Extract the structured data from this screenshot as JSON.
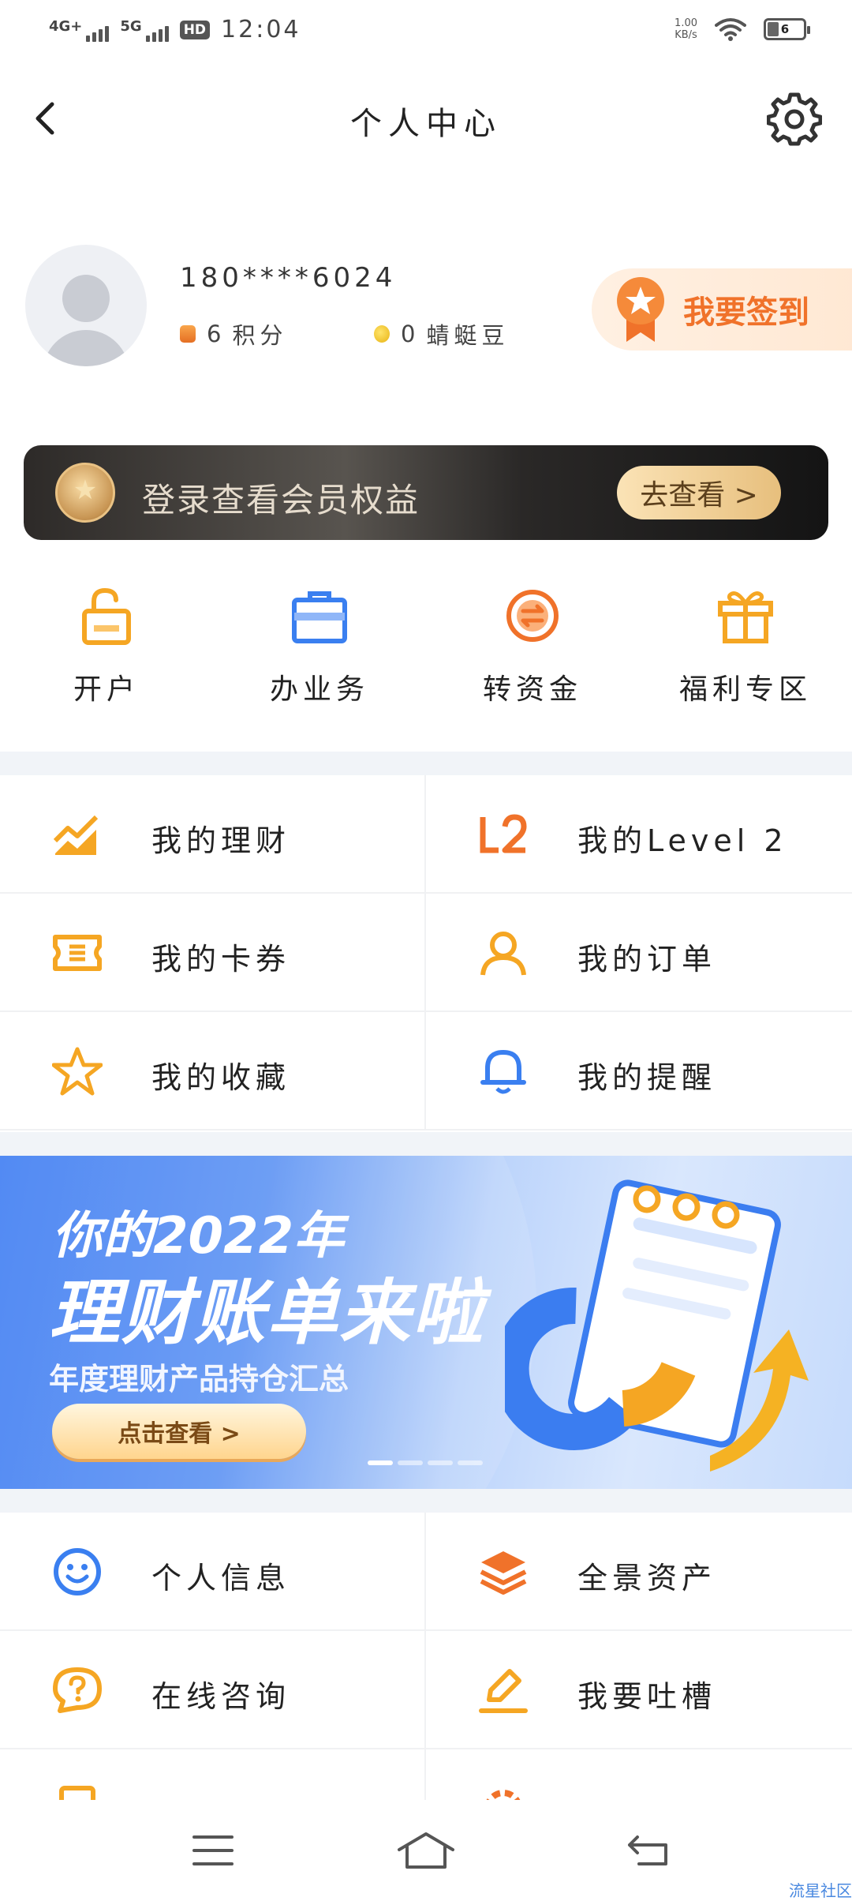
{
  "status_bar": {
    "network_1": "4G+",
    "network_2": "5G",
    "hd": "HD",
    "time": "12:04",
    "speed_value": "1.00",
    "speed_unit": "KB/s",
    "battery": "6"
  },
  "header": {
    "title": "个人中心"
  },
  "profile": {
    "phone": "180****6024",
    "points_value": "6",
    "points_label": "积分",
    "beans_value": "0",
    "beans_label": "蜻蜓豆",
    "checkin_label": "我要签到"
  },
  "vip_banner": {
    "text": "登录查看会员权益",
    "button": "去查看 >"
  },
  "quick_actions": [
    {
      "label": "开户",
      "icon": "lock-open-icon"
    },
    {
      "label": "办业务",
      "icon": "briefcase-icon"
    },
    {
      "label": "转资金",
      "icon": "transfer-icon"
    },
    {
      "label": "福利专区",
      "icon": "gift-icon"
    }
  ],
  "menu_1": [
    {
      "label": "我的理财",
      "icon": "chart-trend-icon"
    },
    {
      "label": "我的Level 2",
      "icon": "level2-icon"
    },
    {
      "label": "我的卡券",
      "icon": "ticket-icon"
    },
    {
      "label": "我的订单",
      "icon": "user-order-icon"
    },
    {
      "label": "我的收藏",
      "icon": "star-icon"
    },
    {
      "label": "我的提醒",
      "icon": "bell-icon"
    }
  ],
  "promo": {
    "title_line1": "你的2022年",
    "title_line2": "理财账单来啦",
    "subtitle": "年度理财产品持仓汇总",
    "button": "点击查看 >",
    "art_label": "理财账单"
  },
  "menu_2": [
    {
      "label": "个人信息",
      "icon": "smiley-icon"
    },
    {
      "label": "全景资产",
      "icon": "layers-icon"
    },
    {
      "label": "在线咨询",
      "icon": "question-bubble-icon"
    },
    {
      "label": "我要吐槽",
      "icon": "edit-pen-icon"
    }
  ],
  "watermark": "流星社区",
  "colors": {
    "accent_orange": "#f0722a",
    "accent_yellow": "#f5a623",
    "accent_blue": "#3a7ff0"
  }
}
